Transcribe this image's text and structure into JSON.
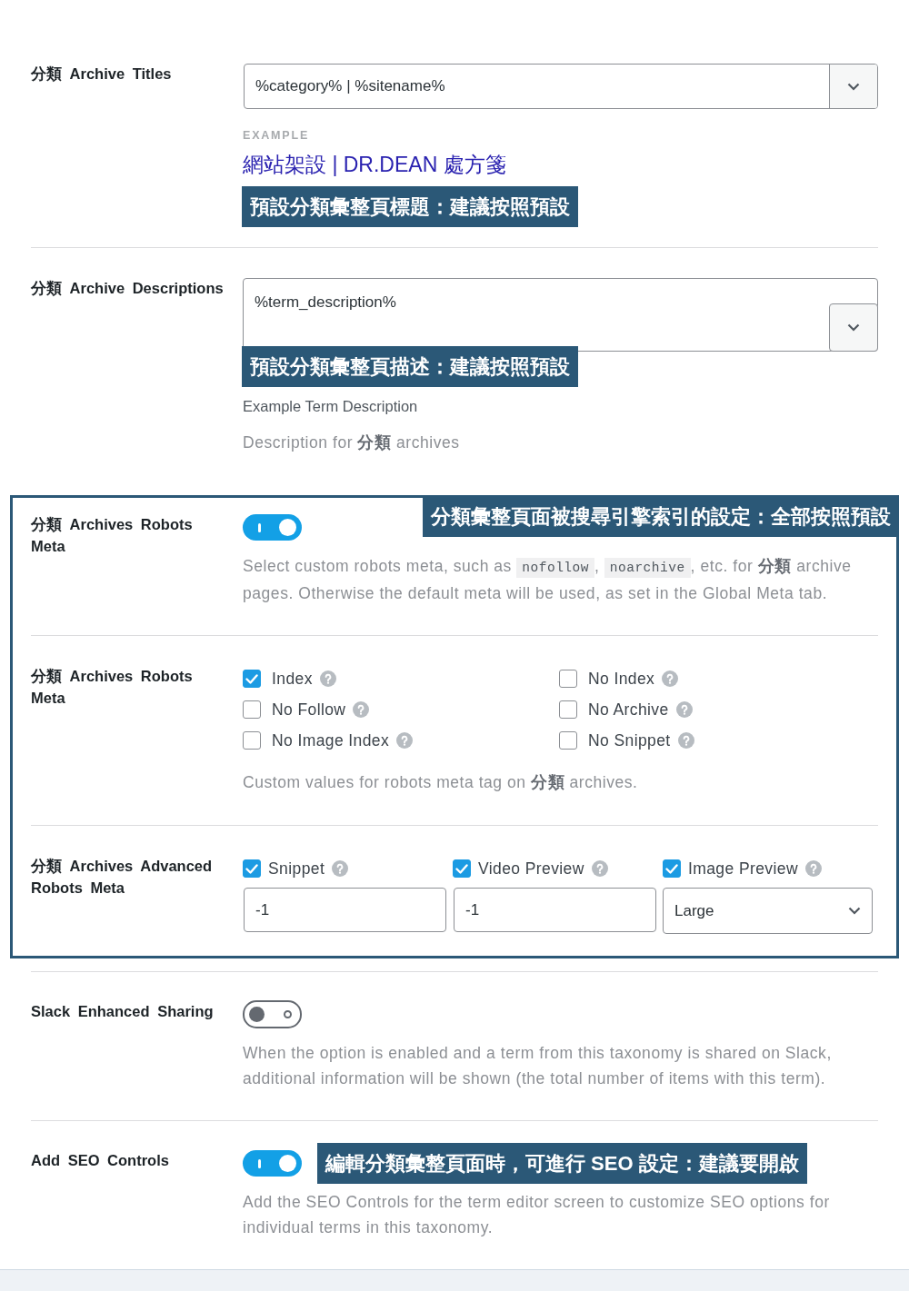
{
  "settings": [
    {
      "kind": "select",
      "label": "分類 Archive Titles",
      "value": "%category% | %sitename%",
      "example_heading": "EXAMPLE",
      "example_title": "網站架設 | DR.DEAN 處方箋",
      "annotation": "預設分類彙整頁標題：建議按照預設"
    },
    {
      "kind": "textarea",
      "label": "分類 Archive Descriptions",
      "value": "%term_description%",
      "annotation": "預設分類彙整頁描述：建議按照預設",
      "example_text": "Example Term Description",
      "description": [
        {
          "kind": "text",
          "text": "Description for **分類** archives"
        }
      ]
    },
    {
      "kind": "group",
      "annotation": "分類彙整頁面被搜尋引擎索引的設定：全部按照預設",
      "settings": [
        {
          "kind": "toggle",
          "label": "分類 Archives Robots Meta",
          "on": true,
          "description": [
            {
              "kind": "text",
              "text": "Select custom robots meta, such as "
            },
            {
              "kind": "code",
              "text": "nofollow"
            },
            {
              "kind": "text",
              "text": ", "
            },
            {
              "kind": "code",
              "text": "noarchive"
            },
            {
              "kind": "text",
              "text": ", etc. for **分類** archive pages. Otherwise the default meta will be used, as set in the Global Meta tab."
            }
          ]
        },
        {
          "kind": "checkbox_grid",
          "label": "分類 Archives Robots Meta",
          "options": [
            {
              "label": "Index",
              "checked": true
            },
            {
              "label": "No Index",
              "checked": false
            },
            {
              "label": "No Follow",
              "checked": false
            },
            {
              "label": "No Archive",
              "checked": false
            },
            {
              "label": "No Image Index",
              "checked": false
            },
            {
              "label": "No Snippet",
              "checked": false
            }
          ],
          "description": [
            {
              "kind": "text",
              "text": "Custom values for robots meta tag on **分類** archives."
            }
          ]
        },
        {
          "kind": "advanced",
          "label": "分類 Archives Advanced Robots Meta",
          "options": [
            {
              "kind": "input",
              "label": "Snippet",
              "checked": true,
              "value": "-1"
            },
            {
              "kind": "input",
              "label": "Video Preview",
              "checked": true,
              "value": "-1"
            },
            {
              "kind": "select",
              "label": "Image Preview",
              "checked": true,
              "value": "Large"
            }
          ]
        }
      ]
    },
    {
      "kind": "toggle",
      "label": "Slack Enhanced Sharing",
      "on": false,
      "description": [
        {
          "kind": "text",
          "text": "When the option is enabled and a term from this taxonomy is shared on Slack, additional information will be shown (the total number of items with this term)."
        }
      ]
    },
    {
      "kind": "toggle",
      "label": "Add SEO Controls",
      "on": true,
      "annotation": "編輯分類彙整頁面時，可進行 SEO 設定：建議要開啟",
      "description": [
        {
          "kind": "text",
          "text": "Add the SEO Controls for the term editor screen to customize SEO options for individual terms in this taxonomy."
        }
      ]
    }
  ]
}
